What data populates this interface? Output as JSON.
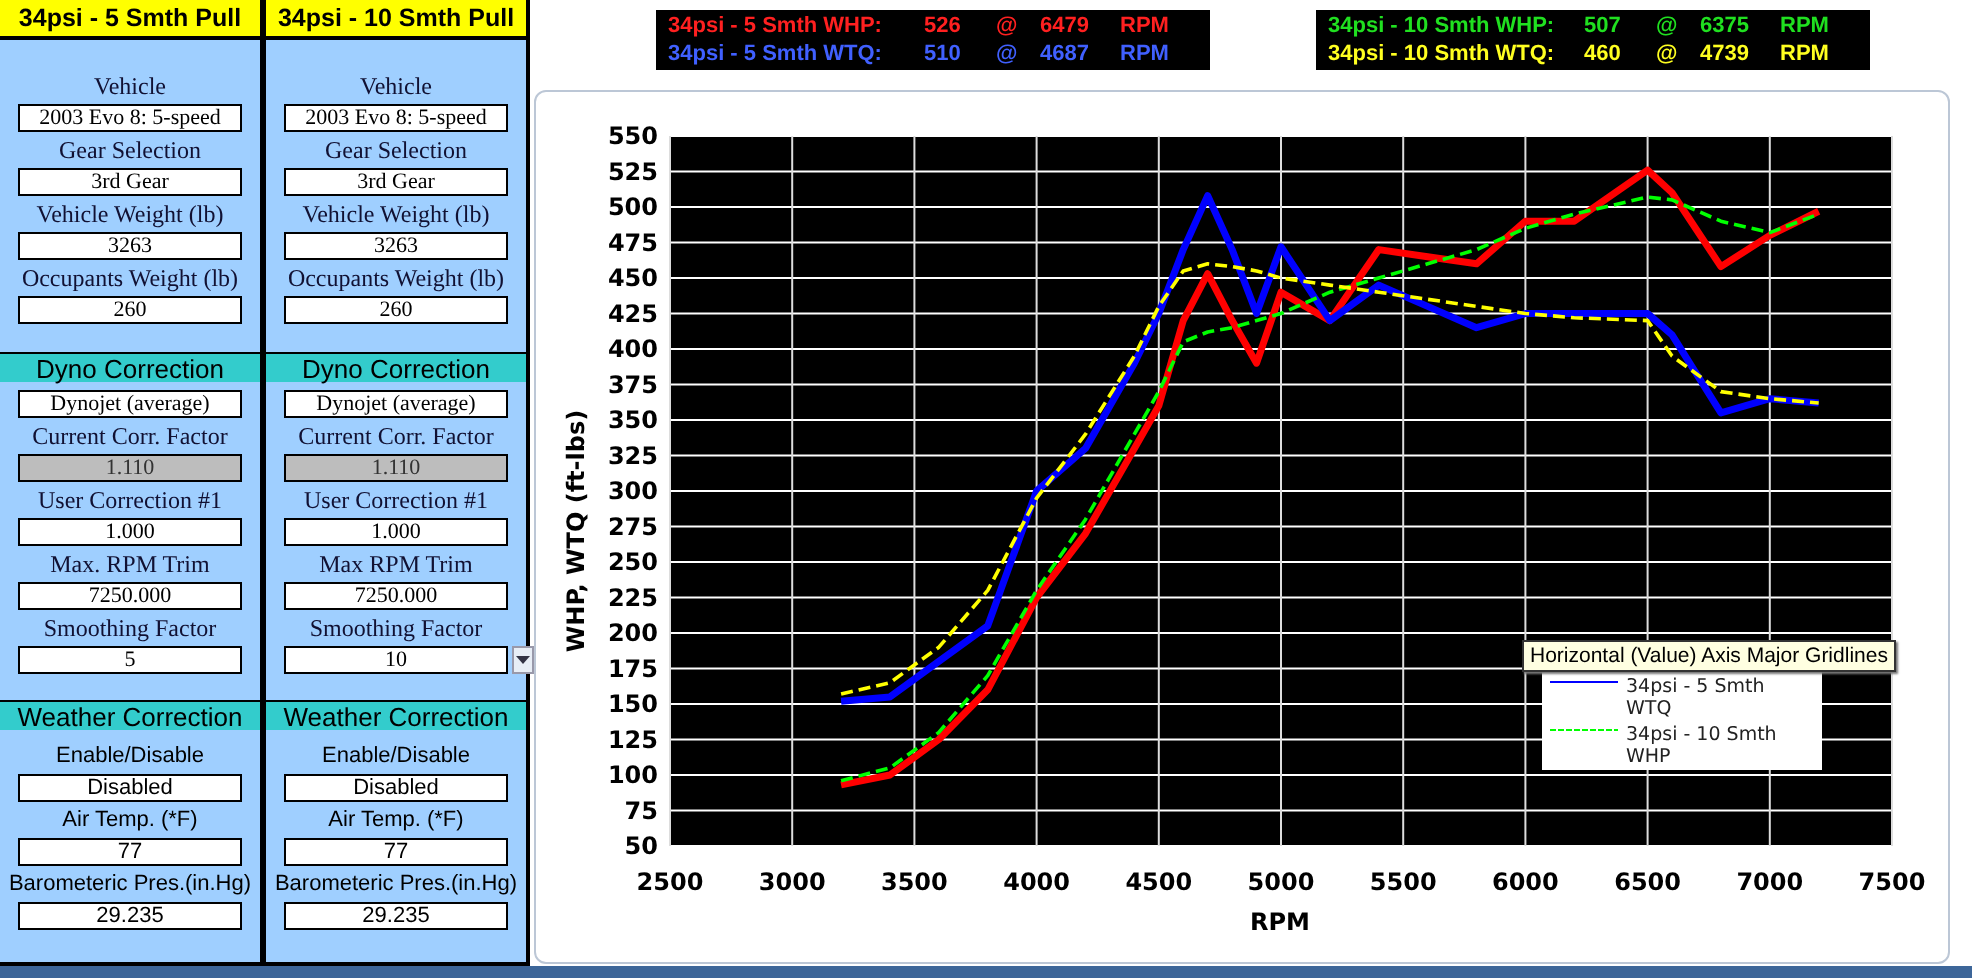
{
  "panels": [
    {
      "title": "34psi - 5 Smth Pull",
      "sections": [
        {
          "kind": "vehicle",
          "fields": [
            {
              "label": "Vehicle",
              "value": "2003 Evo 8: 5-speed",
              "kind": "text"
            },
            {
              "label": "Gear Selection",
              "value": "3rd Gear",
              "kind": "text"
            },
            {
              "label": "Vehicle Weight (lb)",
              "value": "3263",
              "kind": "text"
            },
            {
              "label": "Occupants Weight (lb)",
              "value": "260",
              "kind": "text"
            }
          ]
        },
        {
          "kind": "dyno",
          "header": "Dyno Correction",
          "fields": [
            {
              "value": "Dynojet (average)",
              "kind": "text"
            },
            {
              "label": "Current Corr. Factor",
              "value": "1.110",
              "kind": "computed"
            },
            {
              "label": "User Correction #1",
              "value": "1.000",
              "kind": "text"
            },
            {
              "label": "Max. RPM Trim",
              "value": "7250.000",
              "kind": "text"
            },
            {
              "label": "Smoothing Factor",
              "value": "5",
              "kind": "text"
            }
          ]
        },
        {
          "kind": "weather",
          "header": "Weather Correction",
          "fields": [
            {
              "label": "Enable/Disable",
              "value": "Disabled",
              "kind": "text"
            },
            {
              "label": "Air Temp. (*F)",
              "value": "77",
              "kind": "text"
            },
            {
              "label": "Barometeric Pres.(in.Hg)",
              "value": "29.235",
              "kind": "text"
            }
          ]
        }
      ]
    },
    {
      "title": "34psi - 10 Smth Pull",
      "sections": [
        {
          "kind": "vehicle",
          "fields": [
            {
              "label": "Vehicle",
              "value": "2003 Evo 8: 5-speed",
              "kind": "text"
            },
            {
              "label": "Gear Selection",
              "value": "3rd Gear",
              "kind": "text"
            },
            {
              "label": "Vehicle Weight (lb)",
              "value": "3263",
              "kind": "text"
            },
            {
              "label": "Occupants Weight (lb)",
              "value": "260",
              "kind": "text"
            }
          ]
        },
        {
          "kind": "dyno",
          "header": "Dyno Correction",
          "fields": [
            {
              "value": "Dynojet (average)",
              "kind": "text"
            },
            {
              "label": "Current Corr. Factor",
              "value": "1.110",
              "kind": "computed"
            },
            {
              "label": "User Correction #1",
              "value": "1.000",
              "kind": "text"
            },
            {
              "label": "Max RPM Trim",
              "value": "7250.000",
              "kind": "text"
            },
            {
              "label": "Smoothing Factor",
              "value": "10",
              "kind": "dropdown"
            }
          ]
        },
        {
          "kind": "weather",
          "header": "Weather Correction",
          "fields": [
            {
              "label": "Enable/Disable",
              "value": "Disabled",
              "kind": "text"
            },
            {
              "label": "Air Temp. (*F)",
              "value": "77",
              "kind": "text"
            },
            {
              "label": "Barometeric Pres.(in.Hg)",
              "value": "29.235",
              "kind": "text"
            }
          ]
        }
      ]
    }
  ],
  "readouts": [
    {
      "rows": [
        {
          "label": "34psi - 5 Smth WHP:",
          "value": "526",
          "at": "@",
          "rpm": "6479",
          "unit": "RPM",
          "color": "#ff2020"
        },
        {
          "label": "34psi - 5 Smth WTQ:",
          "value": "510",
          "at": "@",
          "rpm": "4687",
          "unit": "RPM",
          "color": "#4060ff"
        }
      ]
    },
    {
      "rows": [
        {
          "label": "34psi - 10 Smth WHP:",
          "value": "507",
          "at": "@",
          "rpm": "6375",
          "unit": "RPM",
          "color": "#20e020"
        },
        {
          "label": "34psi - 10 Smth WTQ:",
          "value": "460",
          "at": "@",
          "rpm": "4739",
          "unit": "RPM",
          "color": "#ffff20"
        }
      ]
    }
  ],
  "chart": {
    "chart_data": {
      "type": "line",
      "grid": true,
      "xlabel": "RPM",
      "ylabel": "WHP, WTQ (ft-lbs)",
      "xlim": [
        2500,
        7500
      ],
      "ylim": [
        50,
        550
      ],
      "xticks": [
        2500,
        3000,
        3500,
        4000,
        4500,
        5000,
        5500,
        6000,
        6500,
        7000,
        7500
      ],
      "yticks": [
        50,
        75,
        100,
        125,
        150,
        175,
        200,
        225,
        250,
        275,
        300,
        325,
        350,
        375,
        400,
        425,
        450,
        475,
        500,
        525,
        550
      ],
      "x": [
        3200,
        3400,
        3600,
        3800,
        4000,
        4200,
        4400,
        4500,
        4600,
        4700,
        4800,
        4900,
        5000,
        5200,
        5400,
        5600,
        5800,
        6000,
        6200,
        6500,
        6600,
        6800,
        7000,
        7200
      ],
      "series": [
        {
          "color": "#ff0000",
          "line_style": "solid",
          "values": [
            93,
            100,
            125,
            160,
            225,
            270,
            330,
            360,
            420,
            453,
            420,
            390,
            440,
            420,
            470,
            465,
            460,
            490,
            490,
            526,
            510,
            458,
            480,
            497
          ]
        },
        {
          "color": "#0000ff",
          "line_style": "solid",
          "values": [
            152,
            155,
            180,
            205,
            300,
            330,
            390,
            425,
            470,
            508,
            470,
            425,
            472,
            420,
            445,
            430,
            415,
            425,
            425,
            425,
            410,
            355,
            365,
            362
          ]
        },
        {
          "color": "#00ff00",
          "line_style": "dashed",
          "values": [
            96,
            105,
            130,
            170,
            230,
            280,
            340,
            370,
            405,
            412,
            415,
            420,
            425,
            440,
            450,
            460,
            470,
            485,
            495,
            507,
            505,
            490,
            482,
            495
          ]
        },
        {
          "color": "#ffff00",
          "line_style": "dashed",
          "values": [
            157,
            165,
            190,
            230,
            295,
            340,
            395,
            430,
            455,
            460,
            458,
            455,
            450,
            445,
            440,
            435,
            430,
            425,
            422,
            420,
            395,
            370,
            365,
            362
          ]
        }
      ]
    },
    "legend": [
      {
        "label": "34psi - 5 Smth WTQ",
        "color": "#0000ff",
        "dashed": false
      },
      {
        "label": "34psi - 10 Smth WHP",
        "color": "#00ff00",
        "dashed": true
      }
    ],
    "tooltip": "Horizontal (Value) Axis Major Gridlines"
  }
}
